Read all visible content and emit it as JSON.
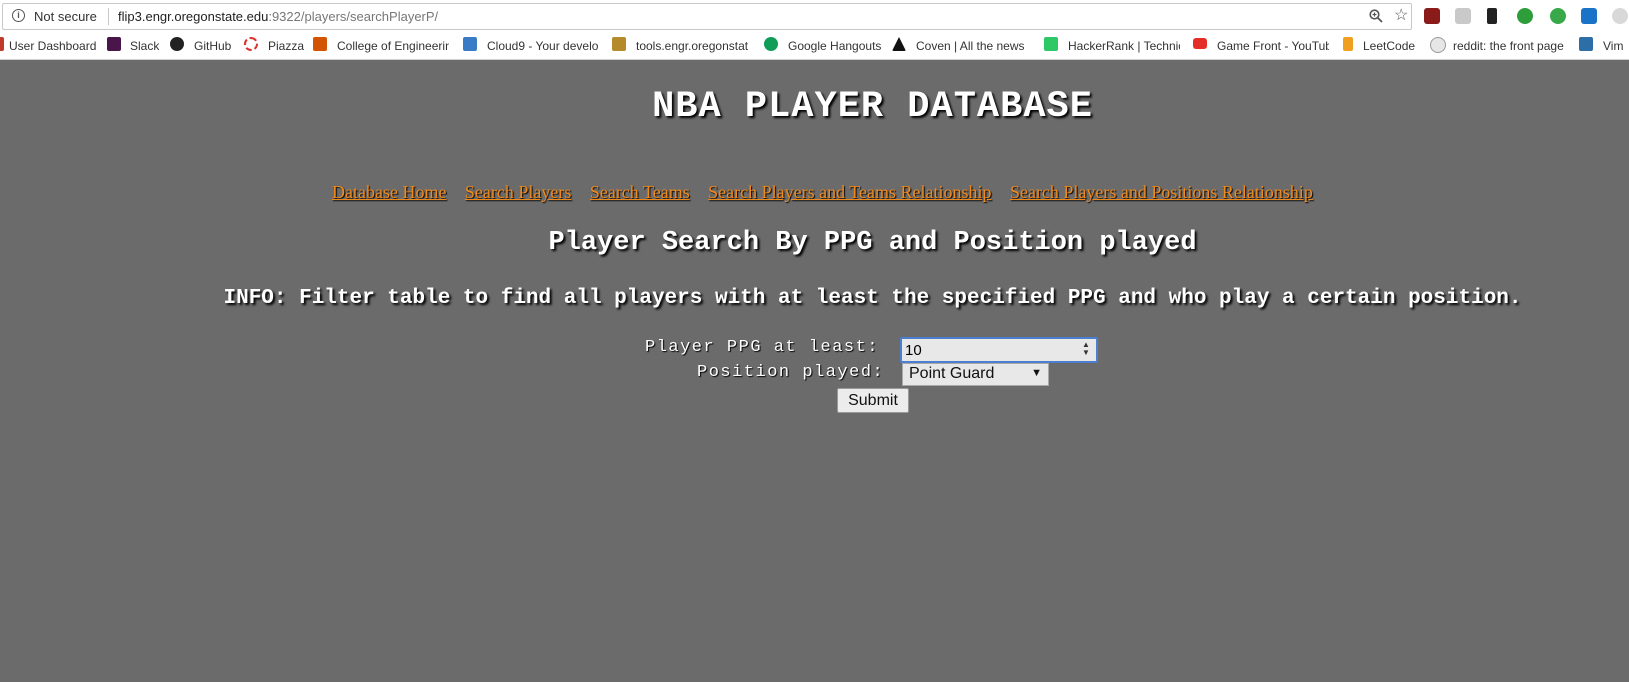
{
  "browser": {
    "security_label": "Not secure",
    "url_host": "flip3.engr.oregonstate.edu",
    "url_path": ":9322/players/searchPlayerP/",
    "bookmarks": [
      {
        "label": "User Dashboard",
        "icon": "dashboard-icon"
      },
      {
        "label": "Slack",
        "icon": "slack-icon"
      },
      {
        "label": "GitHub",
        "icon": "github-icon"
      },
      {
        "label": "Piazza",
        "icon": "piazza-icon"
      },
      {
        "label": "College of Engineerin",
        "icon": "osu-coe-icon"
      },
      {
        "label": "Cloud9 - Your develo",
        "icon": "cloud9-icon"
      },
      {
        "label": "tools.engr.oregonstat",
        "icon": "tools-icon"
      },
      {
        "label": "Google Hangouts",
        "icon": "hangouts-icon"
      },
      {
        "label": "Coven | All the news",
        "icon": "coven-icon"
      },
      {
        "label": "HackerRank | Technic",
        "icon": "hackerrank-icon"
      },
      {
        "label": "Game Front - YouTub",
        "icon": "youtube-icon"
      },
      {
        "label": "LeetCode",
        "icon": "leetcode-icon"
      },
      {
        "label": "reddit: the front page",
        "icon": "reddit-icon"
      },
      {
        "label": "Vim",
        "icon": "vim-icon"
      }
    ]
  },
  "page": {
    "title": "NBA PLAYER DATABASE",
    "nav": [
      "Database Home",
      "Search Players",
      "Search Teams",
      "Search Players and Teams Relationship",
      "Search Players and Positions Relationship"
    ],
    "subtitle": "Player Search By PPG and Position played",
    "info": "INFO: Filter table to find all players with at least the specified PPG and who play a certain position.",
    "form": {
      "ppg_label": "Player PPG at least:",
      "ppg_value": "10",
      "position_label": "Position played:",
      "position_value": "Point Guard",
      "submit_label": "Submit"
    }
  },
  "colors": {
    "background": "#6b6b6b",
    "link": "#f28a1a"
  }
}
